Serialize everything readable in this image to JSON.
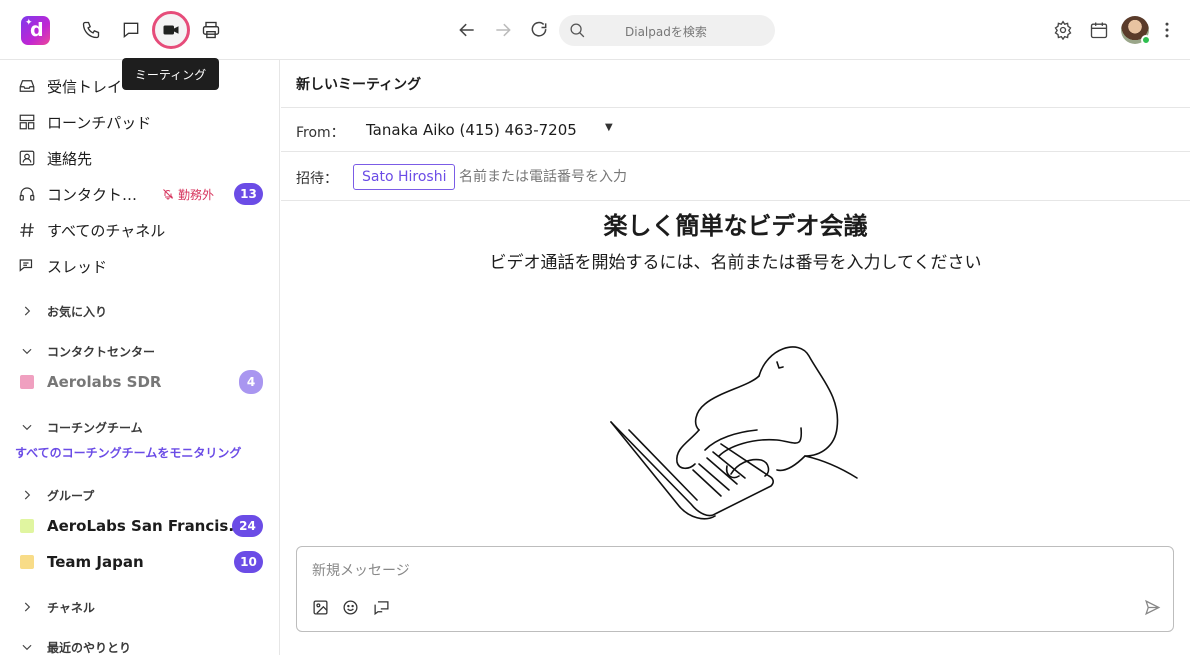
{
  "topbar": {
    "logo_letter": "d",
    "tooltip": "ミーティング",
    "search_placeholder": "Dialpadを検索",
    "icons": [
      "phone-icon",
      "chat-icon",
      "video-icon",
      "printer-icon",
      "back-icon",
      "forward-icon",
      "refresh-icon",
      "search-icon",
      "gear-icon",
      "calendar-icon",
      "more-icon"
    ],
    "presence_color": "#2ebf4f"
  },
  "sidebar": {
    "nav": [
      {
        "label": "受信トレイ",
        "icon": "inbox-icon"
      },
      {
        "label": "ローンチパッド",
        "icon": "launchpad-icon"
      },
      {
        "label": "連絡先",
        "icon": "contacts-icon"
      },
      {
        "label": "コンタクト…",
        "icon": "headset-icon",
        "status": "勤務外",
        "badge": "13"
      },
      {
        "label": "すべてのチャネル",
        "icon": "hash-icon"
      },
      {
        "label": "スレッド",
        "icon": "threads-icon"
      }
    ],
    "sections": {
      "favorites": "お気に入り",
      "contact_center": "コンタクトセンター",
      "coaching": "コーチングチーム",
      "groups": "グループ",
      "channels": "チャネル",
      "recent": "最近のやりとり"
    },
    "contact_center_items": [
      {
        "label": "Aerolabs SDR",
        "badge": "4",
        "color": "#f0a0c0"
      }
    ],
    "coaching_link": "すべてのコーチングチームをモニタリング",
    "group_items": [
      {
        "label": "AeroLabs San Francis...",
        "badge": "24",
        "color": "#e0f5a0"
      },
      {
        "label": "Team Japan",
        "badge": "10",
        "color": "#f8dc88"
      }
    ]
  },
  "main": {
    "title": "新しいミーティング",
    "from_label": "From：",
    "from_value": "Tanaka Aiko (415) 463-7205",
    "invite_label": "招待：",
    "invitee": "Sato Hiroshi",
    "invite_placeholder": "名前または電話番号を入力",
    "hero_title": "楽しく簡単なビデオ会議",
    "hero_subtitle": "ビデオ通話を開始するには、名前または番号を入力してください",
    "message_placeholder": "新規メッセージ",
    "accent_color": "#6b4ce6"
  }
}
